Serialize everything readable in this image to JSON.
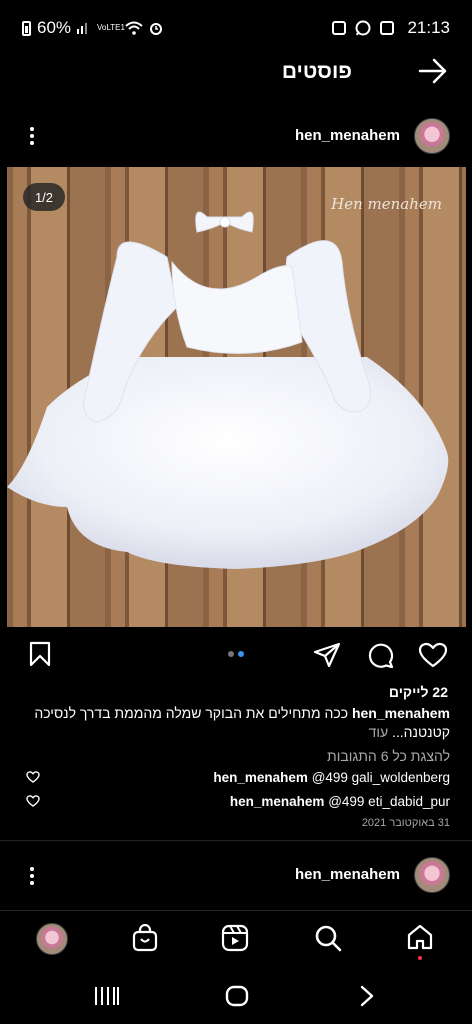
{
  "status_bar": {
    "battery": "60%",
    "network": "VoLTE1",
    "time": "21:13"
  },
  "header": {
    "title": "פוסטים"
  },
  "post": {
    "username": "hen_menahem",
    "image_counter": "1/2",
    "watermark": "Hen menahem",
    "carousel_total": 2,
    "carousel_active": 2,
    "likes": "22 לייקים",
    "caption_user": "hen_menahem",
    "caption_text": "ככה מתחילים את הבוקר שמלה מהממת בדרך לנסיכה קטנטנה...",
    "caption_more": "עוד",
    "view_all_comments": "להצגת כל 6 התגובות",
    "comments": [
      {
        "user": "hen_menahem",
        "text": "@499 gali_woldenberg"
      },
      {
        "user": "hen_menahem",
        "text": "@499 eti_dabid_pur"
      }
    ],
    "date": "31 באוקטובר 2021"
  },
  "next_post": {
    "username": "hen_menahem"
  },
  "bottom_nav": [
    "home-icon",
    "search-icon",
    "reels-icon",
    "shop-icon",
    "profile-avatar"
  ],
  "colors": {
    "background": "#000000",
    "accent_blue": "#3897f0",
    "notification_red": "#ff3040",
    "muted_text": "#a8a8a8"
  }
}
